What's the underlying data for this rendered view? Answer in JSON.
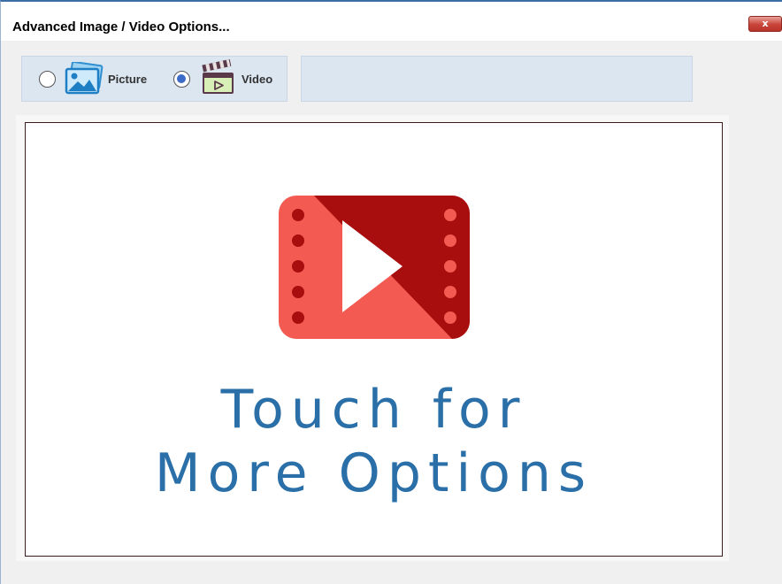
{
  "window": {
    "title": "Advanced Image / Video Options...",
    "close_label": "x"
  },
  "media_type": {
    "selected": "video",
    "options": [
      {
        "id": "picture",
        "label": "Picture",
        "icon": "picture-icon",
        "checked": false
      },
      {
        "id": "video",
        "label": "Video",
        "icon": "clapperboard-icon",
        "checked": true
      }
    ]
  },
  "preview": {
    "icon": "video-play-icon",
    "line1": "Touch for",
    "line2": "More Options",
    "text_color": "#2a6fa8"
  },
  "colors": {
    "accent": "#3c6cc8",
    "panel": "#dce6f1",
    "video_red": "#e8504a",
    "video_dark": "#a80e0e"
  }
}
